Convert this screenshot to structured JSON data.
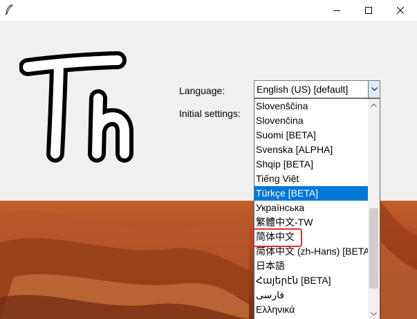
{
  "window": {
    "icon": "feather-icon",
    "controls": [
      "minimize-icon",
      "maximize-icon",
      "close-icon"
    ]
  },
  "form": {
    "language_label": "Language:",
    "initial_settings_label": "Initial settings:"
  },
  "language_select": {
    "value": "English (US) [default]",
    "options": [
      "Slovenščina",
      "Slovenčina",
      "Suomi [BETA]",
      "Svenska [ALPHA]",
      "Shqip [BETA]",
      "Tiếng Việt",
      "Türkçe [BETA]",
      "Українська",
      "繁體中文-TW",
      "简体中文",
      "简体中文 (zh-Hans) [BETA]",
      "日本語",
      "Հայերէն [BETA]",
      "فارسی",
      "Ελληνικά"
    ],
    "highlighted_option": "Türkçe [BETA]",
    "annotated_option": "简体中文"
  },
  "colors": {
    "selection": "#0078d7",
    "annotation": "#e0302c",
    "dialog_bg": "#f0f0f0"
  }
}
